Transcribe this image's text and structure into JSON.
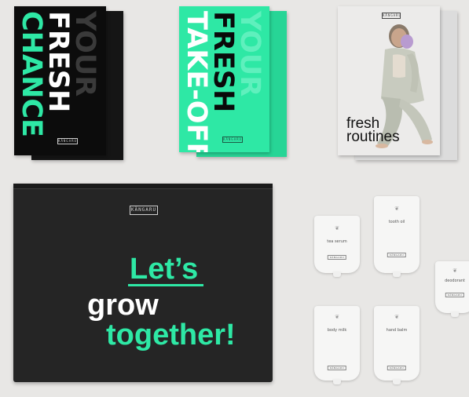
{
  "booklet_chance": {
    "line1": "YOUR",
    "line2": "FRESH",
    "line3": "CHANCE",
    "brand": "KÄNGARU"
  },
  "booklet_takeoff": {
    "line1": "YOUR",
    "line2": "FRESH",
    "line3": "TAKE-OFF",
    "brand": "KÄNGARU"
  },
  "booklet_routines": {
    "line1": "fresh",
    "line2": "routines",
    "brand": "KÄNGARU"
  },
  "bag": {
    "brand": "KÄNGARU",
    "line1": "Let’s",
    "line2": "grow",
    "line3": "together!"
  },
  "pouches": {
    "tea_serum": "tea serum",
    "tooth_oil": "tooth oil",
    "deodorant": "deodorant",
    "body_milk": "body milk",
    "hand_balm": "hand balm",
    "brand": "KÄNGARU"
  },
  "colors": {
    "mint": "#2ee8a5",
    "bag": "#252525",
    "background": "#e8e7e5"
  }
}
